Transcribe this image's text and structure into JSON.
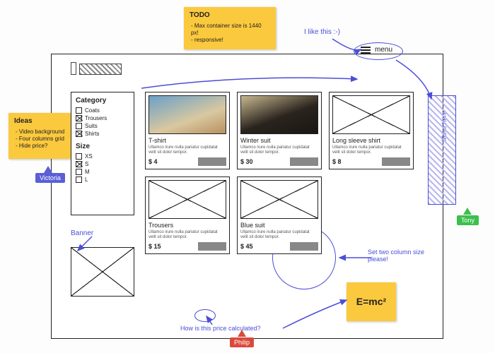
{
  "notes": {
    "todo": {
      "title": "TODO",
      "items": [
        "Max container size is 1440 px!",
        "responsive!"
      ]
    },
    "ideas": {
      "title": "Ideas",
      "items": [
        "Video background",
        "Four columns grid",
        "Hide price?"
      ]
    },
    "formula": "E=mc²"
  },
  "users": {
    "victoria": "Victoria",
    "tony": "Tony",
    "philip": "Philip"
  },
  "annotations": {
    "like": "I like this :-)",
    "banner": "Banner",
    "move": "Move here",
    "twocol": "Set two column size please!",
    "price_q": "How is this price calculated?"
  },
  "menu": {
    "label": "menu"
  },
  "filter": {
    "category_title": "Category",
    "categories": [
      {
        "label": "Coats",
        "checked": false
      },
      {
        "label": "Trousers",
        "checked": true
      },
      {
        "label": "Suits",
        "checked": false
      },
      {
        "label": "Shirts",
        "checked": true
      }
    ],
    "size_title": "Size",
    "sizes": [
      {
        "label": "XS",
        "checked": false
      },
      {
        "label": "S",
        "checked": true
      },
      {
        "label": "M",
        "checked": false
      },
      {
        "label": "L",
        "checked": false
      }
    ]
  },
  "lorem": "Ullamco irure nulla pariatur cupidatat velit sit dolor tempor.",
  "products": [
    {
      "name": "T-shirt",
      "price": "$ 4",
      "photo": "photo1"
    },
    {
      "name": "Winter suit",
      "price": "$ 30",
      "photo": "photo2"
    },
    {
      "name": "Long sleeve shirt",
      "price": "$ 8",
      "photo": "ph"
    },
    {
      "name": "Trousers",
      "price": "$ 15",
      "photo": "ph"
    },
    {
      "name": "Blue suit",
      "price": "$ 45",
      "photo": "ph"
    }
  ]
}
